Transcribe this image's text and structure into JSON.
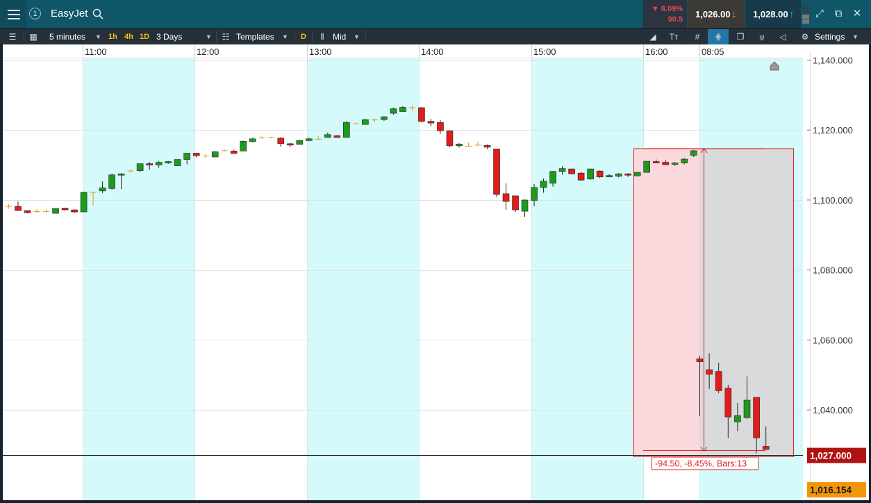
{
  "header": {
    "menu_icon": "hamburger-icon",
    "link_group": "1",
    "instrument": "EasyJet",
    "change_pct": "▼ 8.09%",
    "change_points": "90.5",
    "sell_price": "1,026.00",
    "buy_price": "1,028.00",
    "icons": [
      "expand-icon",
      "popout-icon",
      "close-icon"
    ]
  },
  "toolbar": {
    "interval": "5 minutes",
    "quick_1h": "1h",
    "quick_4h": "4h",
    "quick_1d": "1D",
    "period": "3 Days",
    "templates": "Templates",
    "d_badge": "D",
    "price_type": "Mid",
    "settings": "Settings"
  },
  "colors": {
    "up": "#1e9a1e",
    "down": "#e21b1b",
    "session_shade": "#d5fafb",
    "measure_red_fill": "#fbd8dc",
    "measure_grey_fill": "#d8dadb",
    "last_price_bg": "#b01212",
    "bid_tag_bg": "#f2960a"
  },
  "chart_data": {
    "type": "candlestick",
    "x_labels": [
      "11:00",
      "12:00",
      "13:00",
      "14:00",
      "15:00",
      "16:00",
      "08:05"
    ],
    "y_ticks": [
      1040,
      1060,
      1080,
      1100,
      1120,
      1140
    ],
    "y_tick_labels": [
      "1,040.000",
      "1,060.000",
      "1,080.000",
      "1,100.000",
      "1,120.000",
      "1,140.000"
    ],
    "ylim": [
      1014.2,
      1140.5
    ],
    "grid": true,
    "candles": [
      [
        1098.3,
        1099.0,
        1097.5,
        1098.4
      ],
      [
        1098.2,
        1099.6,
        1097.0,
        1097.0
      ],
      [
        1097.0,
        1097.0,
        1096.2,
        1096.4
      ],
      [
        1096.8,
        1097.4,
        1096.4,
        1096.8
      ],
      [
        1096.8,
        1097.5,
        1096.4,
        1096.8
      ],
      [
        1096.2,
        1097.6,
        1096.2,
        1097.6
      ],
      [
        1097.7,
        1097.8,
        1097.0,
        1097.2
      ],
      [
        1097.2,
        1097.3,
        1096.4,
        1096.6
      ],
      [
        1096.6,
        1102.4,
        1096.6,
        1102.2
      ],
      [
        1102.3,
        1102.5,
        1098.6,
        1102.4
      ],
      [
        1102.6,
        1105.3,
        1102.0,
        1103.5
      ],
      [
        1103.3,
        1107.5,
        1103.0,
        1107.2
      ],
      [
        1107.2,
        1107.7,
        1103.1,
        1107.5
      ],
      [
        1108.4,
        1108.8,
        1108.0,
        1108.5
      ],
      [
        1108.4,
        1110.0,
        1108.0,
        1110.4
      ],
      [
        1110.4,
        1110.9,
        1108.6,
        1110.0
      ],
      [
        1110.0,
        1111.2,
        1109.2,
        1110.8
      ],
      [
        1110.8,
        1111.2,
        1110.3,
        1111.0
      ],
      [
        1109.8,
        1111.4,
        1109.8,
        1111.6
      ],
      [
        1111.6,
        1113.2,
        1110.2,
        1113.4
      ],
      [
        1113.4,
        1113.5,
        1112.2,
        1112.7
      ],
      [
        1112.7,
        1113.2,
        1112.1,
        1112.6
      ],
      [
        1112.3,
        1114.0,
        1112.3,
        1113.8
      ],
      [
        1114.2,
        1114.5,
        1113.9,
        1114.3
      ],
      [
        1114.0,
        1114.4,
        1113.3,
        1113.3
      ],
      [
        1114.0,
        1117.0,
        1114.0,
        1116.8
      ],
      [
        1116.7,
        1117.8,
        1116.5,
        1117.5
      ],
      [
        1117.9,
        1118.2,
        1117.5,
        1117.9
      ],
      [
        1117.9,
        1118.1,
        1117.8,
        1117.9
      ],
      [
        1117.7,
        1118.0,
        1115.2,
        1116.1
      ],
      [
        1116.1,
        1116.4,
        1115.2,
        1115.9
      ],
      [
        1115.9,
        1117.2,
        1115.9,
        1117.0
      ],
      [
        1117.0,
        1117.8,
        1116.8,
        1117.5
      ],
      [
        1117.5,
        1118.2,
        1117.2,
        1117.6
      ],
      [
        1117.9,
        1119.3,
        1117.8,
        1118.7
      ],
      [
        1118.4,
        1118.6,
        1117.8,
        1117.9
      ],
      [
        1117.9,
        1122.5,
        1117.9,
        1122.2
      ],
      [
        1121.9,
        1122.2,
        1121.8,
        1122.0
      ],
      [
        1121.6,
        1123.2,
        1121.6,
        1123.0
      ],
      [
        1123.0,
        1123.3,
        1122.3,
        1123.0
      ],
      [
        1123.0,
        1124.0,
        1122.6,
        1123.8
      ],
      [
        1124.8,
        1126.4,
        1124.4,
        1126.1
      ],
      [
        1125.3,
        1126.8,
        1125.3,
        1126.5
      ],
      [
        1126.5,
        1127.0,
        1125.5,
        1126.4
      ],
      [
        1126.4,
        1126.6,
        1122.2,
        1122.5
      ],
      [
        1122.5,
        1123.2,
        1121.0,
        1122.0
      ],
      [
        1122.2,
        1122.8,
        1118.9,
        1119.8
      ],
      [
        1119.8,
        1119.9,
        1115.1,
        1115.5
      ],
      [
        1115.5,
        1116.3,
        1115.0,
        1116.0
      ],
      [
        1115.5,
        1116.4,
        1115.5,
        1115.6
      ],
      [
        1115.8,
        1116.8,
        1115.5,
        1115.9
      ],
      [
        1115.6,
        1115.9,
        1114.6,
        1115.1
      ],
      [
        1114.6,
        1114.6,
        1100.9,
        1101.6
      ],
      [
        1101.8,
        1104.8,
        1097.2,
        1099.6
      ],
      [
        1101.2,
        1101.2,
        1096.6,
        1097.2
      ],
      [
        1096.8,
        1100.2,
        1095.2,
        1100.0
      ],
      [
        1099.9,
        1104.6,
        1098.2,
        1103.6
      ],
      [
        1103.6,
        1106.2,
        1102.1,
        1105.4
      ],
      [
        1104.8,
        1108.3,
        1103.8,
        1108.2
      ],
      [
        1108.2,
        1109.7,
        1107.2,
        1109.0
      ],
      [
        1108.9,
        1109.0,
        1107.3,
        1107.5
      ],
      [
        1107.7,
        1108.1,
        1105.5,
        1105.7
      ],
      [
        1106.0,
        1109.0,
        1105.8,
        1108.9
      ],
      [
        1108.3,
        1108.5,
        1106.3,
        1106.6
      ],
      [
        1106.8,
        1107.4,
        1106.5,
        1107.0
      ],
      [
        1106.8,
        1107.7,
        1106.5,
        1107.5
      ],
      [
        1107.5,
        1107.7,
        1106.6,
        1107.1
      ],
      [
        1106.9,
        1108.0,
        1106.9,
        1107.9
      ],
      [
        1107.9,
        1111.1,
        1107.9,
        1111.1
      ],
      [
        1111.0,
        1111.6,
        1110.7,
        1110.6
      ],
      [
        1110.8,
        1111.4,
        1110.0,
        1110.1
      ],
      [
        1110.4,
        1110.9,
        1109.8,
        1110.6
      ],
      [
        1110.6,
        1112.0,
        1110.2,
        1111.7
      ],
      [
        1112.8,
        1114.3,
        1112.3,
        1114.1
      ],
      [
        1054.6,
        1055.5,
        1038.2,
        1053.8
      ],
      [
        1051.5,
        1056.2,
        1046.0,
        1050.2
      ],
      [
        1051.0,
        1053.5,
        1044.8,
        1045.5
      ],
      [
        1046.2,
        1047.2,
        1032.0,
        1038.0
      ],
      [
        1036.6,
        1042.0,
        1034.0,
        1038.4
      ],
      [
        1037.8,
        1049.6,
        1037.4,
        1042.8
      ],
      [
        1043.6,
        1043.6,
        1027.6,
        1032.0
      ],
      [
        1029.6,
        1035.3,
        1029.0,
        1028.7
      ]
    ],
    "last_price_label": "1,027.000",
    "bid_label": "1,016.154",
    "measure_label": "-94.50, -8.45%, Bars:13"
  }
}
